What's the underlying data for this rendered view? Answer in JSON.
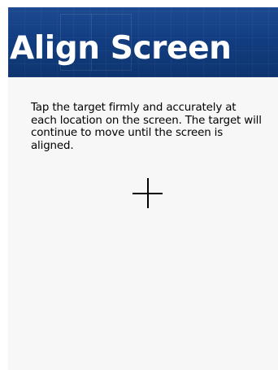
{
  "header": {
    "title": "Align Screen"
  },
  "instructions": {
    "text": "Tap the target firmly and accurately at each location on the screen. The target will continue to move until the screen is aligned."
  },
  "target": {
    "icon": "crosshair-icon"
  },
  "colors": {
    "header_background": "#123d81",
    "screen_background": "#f7f7f7",
    "title_text": "#ffffff",
    "body_text": "#000000"
  }
}
